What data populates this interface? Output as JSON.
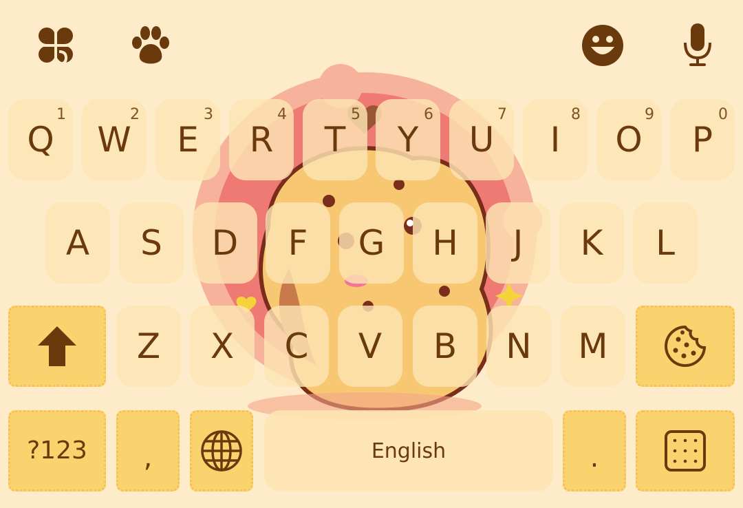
{
  "colors": {
    "background": "#fdebc9",
    "key_fill": "#fde4b3",
    "biscuit_fill": "#fbd36e",
    "glyph": "#6b3a0c"
  },
  "topbar": {
    "left_icons": [
      "clover-icon",
      "paw-icon"
    ],
    "right_icons": [
      "smiley-icon",
      "microphone-icon"
    ]
  },
  "rows": {
    "row1": [
      {
        "label": "Q",
        "hint": "1"
      },
      {
        "label": "W",
        "hint": "2"
      },
      {
        "label": "E",
        "hint": "3"
      },
      {
        "label": "R",
        "hint": "4"
      },
      {
        "label": "T",
        "hint": "5"
      },
      {
        "label": "Y",
        "hint": "6"
      },
      {
        "label": "U",
        "hint": "7"
      },
      {
        "label": "I",
        "hint": "8"
      },
      {
        "label": "O",
        "hint": "9"
      },
      {
        "label": "P",
        "hint": "0"
      }
    ],
    "row2": [
      "A",
      "S",
      "D",
      "F",
      "G",
      "H",
      "J",
      "K",
      "L"
    ],
    "row3": [
      "Z",
      "X",
      "C",
      "V",
      "B",
      "N",
      "M"
    ]
  },
  "bottom": {
    "symbols_label": "?123",
    "comma_label": ",",
    "space_label": "English",
    "period_label": "."
  },
  "icons": {
    "shift": "shift-arrow-icon",
    "backspace": "cookie-icon",
    "language": "globe-icon",
    "enter": "cracker-icon"
  }
}
